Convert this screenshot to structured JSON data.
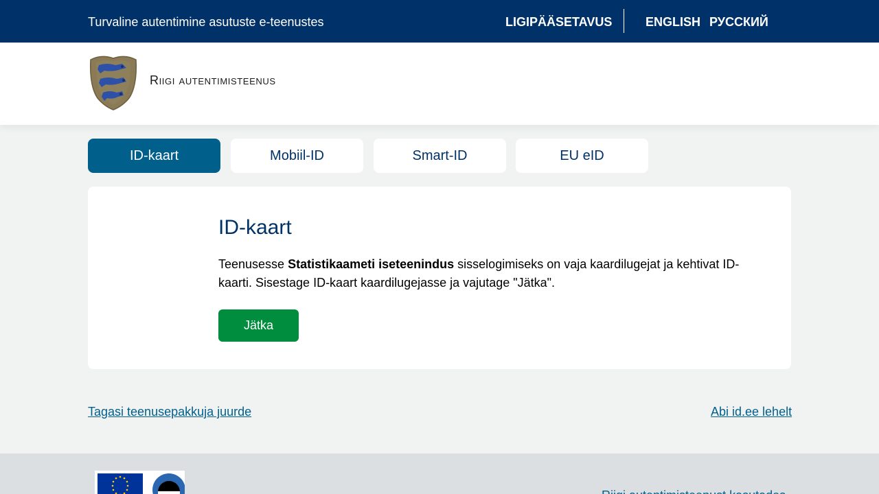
{
  "topbar": {
    "tagline": "Turvaline autentimine asutuste e-teenustes",
    "accessibility": "LIGIPÄÄSETAVUS",
    "english": "ENGLISH",
    "russian": "РУССКИЙ"
  },
  "header": {
    "logo_text": "Riigi autentimisteenus"
  },
  "tabs": [
    {
      "label": "ID-kaart",
      "active": true
    },
    {
      "label": "Mobiil-ID",
      "active": false
    },
    {
      "label": "Smart-ID",
      "active": false
    },
    {
      "label": "EU eID",
      "active": false
    }
  ],
  "card": {
    "title": "ID-kaart",
    "desc_before": "Teenusesse ",
    "desc_service": "Statistikaameti iseteenindus",
    "desc_after": " sisselogimiseks on vaja kaardilugejat ja kehtivat ID-kaarti. Sisestage ID-kaart kaardilugejasse ja vajutage \"Jätka\".",
    "continue_button": "Jätka"
  },
  "links": {
    "back": "Tagasi teenusepakkuja juurde",
    "help": "Abi id.ee lehelt"
  },
  "footer": {
    "link": "Riigi autentimisteenust kasutades"
  },
  "colors": {
    "topbar": "#003168",
    "active_tab": "#005f8b",
    "primary_button": "#008d3d",
    "link": "#005f8b"
  }
}
